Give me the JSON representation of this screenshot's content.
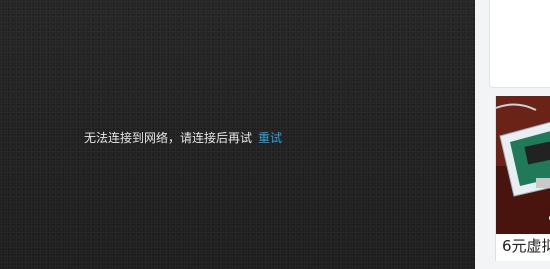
{
  "player": {
    "error_message": "无法连接到网络，请连接后再试",
    "retry_label": "重试"
  },
  "sidebar": {
    "promo": {
      "caption": "6元虚拟",
      "image_icon": "device-photo-icon"
    }
  },
  "colors": {
    "player_bg": "#232323",
    "message_text": "#e6e6e6",
    "retry_link": "#2aa3e0",
    "sidebar_bg": "#f3f4f6"
  }
}
